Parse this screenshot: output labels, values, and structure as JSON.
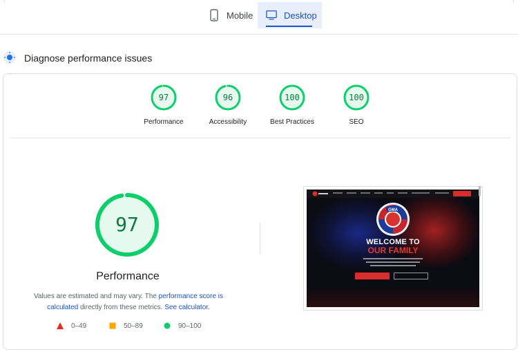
{
  "device_tabs": {
    "mobile_label": "Mobile",
    "desktop_label": "Desktop",
    "selected": "Desktop",
    "mobile_icon": "smartphone-icon",
    "desktop_icon": "monitor-icon"
  },
  "section": {
    "title": "Diagnose performance issues",
    "icon": "diagnose-icon"
  },
  "categories": [
    {
      "label": "Performance",
      "score": "97"
    },
    {
      "label": "Accessibility",
      "score": "96"
    },
    {
      "label": "Best Practices",
      "score": "100"
    },
    {
      "label": "SEO",
      "score": "100"
    }
  ],
  "main_gauge": {
    "score": "97",
    "label": "Performance"
  },
  "note": {
    "part1": "Values are estimated and may vary. The ",
    "link1": "performance score is calculated",
    "part2": " directly from these metrics. ",
    "link2": "See calculator."
  },
  "legend": {
    "fail": "0–49",
    "average": "50–89",
    "pass": "90–100"
  },
  "screenshot": {
    "hero_line1": "WELCOME TO",
    "hero_line2": "OUR FAMILY",
    "logo_text": "GMA"
  },
  "colors": {
    "pass_green": "#0cce6b",
    "pass_fill": "#e6f9ee",
    "pass_text": "#0c7a3f",
    "fail_red": "#e52d26",
    "average_orange": "#ffa400",
    "link_blue": "#1a53c8"
  }
}
